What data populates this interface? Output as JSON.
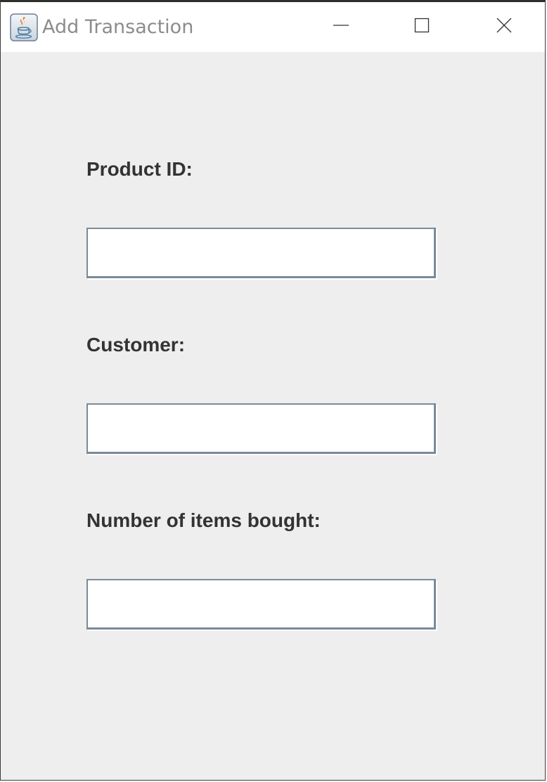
{
  "window": {
    "title": "Add Transaction",
    "icon": "java-icon",
    "controls": {
      "minimize": "minimize-icon",
      "maximize": "maximize-icon",
      "close": "close-icon"
    }
  },
  "form": {
    "product_id_label": "Product ID:",
    "product_id_value": "",
    "customer_label": "Customer:",
    "customer_value": "",
    "items_bought_label": "Number of items bought:",
    "items_bought_value": ""
  },
  "colors": {
    "background": "#eeeeee",
    "titlebar": "#ffffff",
    "label_text": "#333333",
    "field_border": "#7a8a99"
  }
}
